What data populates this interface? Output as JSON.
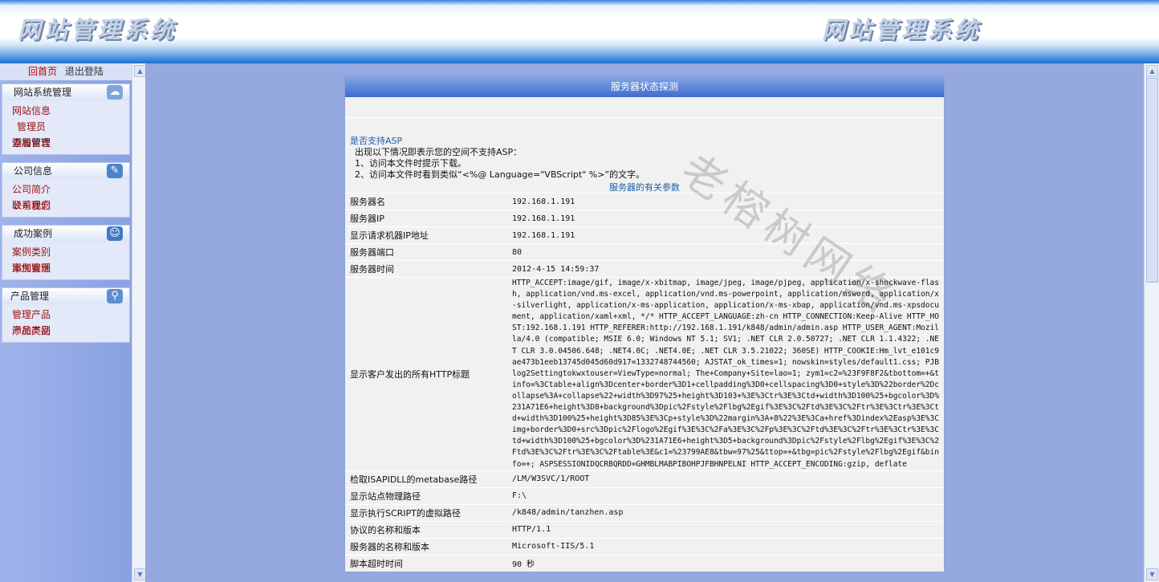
{
  "header": {
    "logo_left": "网站管理系统",
    "logo_right": "网站管理系统"
  },
  "sidebar": {
    "home": "回首页",
    "logout": "退出登陆",
    "groups": [
      {
        "title": "网站系统管理",
        "icon": "network-icon",
        "rows": [
          [
            "网站信息"
          ],
          [
            "管理员",
            "添加管理"
          ],
          [
            "查看留言"
          ]
        ]
      },
      {
        "title": "公司信息",
        "icon": "edit-icon",
        "rows": [
          [
            "公司简介",
            "联系我们"
          ],
          [
            "公司理念"
          ]
        ]
      },
      {
        "title": "成功案例",
        "icon": "user-icon",
        "rows": [
          [
            "案例类别",
            "案例管理"
          ],
          [
            "添加案例"
          ]
        ]
      },
      {
        "title": "产品管理",
        "icon": "search-icon",
        "rows": [
          [
            "管理产品",
            "添加产品"
          ],
          [
            "产品类别"
          ]
        ]
      }
    ]
  },
  "panel": {
    "title": "服务器状态探测",
    "asp_title": "是否支持ASP",
    "asp_line1": "出现以下情况即表示您的空间不支持ASP：",
    "asp_line2": "1、访问本文件时提示下载。",
    "asp_line3": "2、访问本文件时看到类似“<%@ Language=\"VBScript\" %>”的文字。",
    "section_title": "服务器的有关参数",
    "rows": [
      {
        "key": "服务器名",
        "value": "192.168.1.191"
      },
      {
        "key": "服务器IP",
        "value": "192.168.1.191"
      },
      {
        "key": "显示请求机器IP地址",
        "value": "192.168.1.191"
      },
      {
        "key": "服务器端口",
        "value": "80"
      },
      {
        "key": "服务器时间",
        "value": "2012-4-15 14:59:37"
      },
      {
        "key": "显示客户发出的所有HTTP标题",
        "long": true,
        "value": " HTTP_ACCEPT:image/gif, image/x-xbitmap, image/jpeg, image/pjpeg, application/x-shockwave-flash, application/vnd.ms-excel, application/vnd.ms-powerpoint, application/msword, application/x-silverlight, application/x-ms-application, application/x-ms-xbap, application/vnd.ms-xpsdocument, application/xaml+xml, */* HTTP_ACCEPT_LANGUAGE:zh-cn HTTP_CONNECTION:Keep-Alive HTTP_HOST:192.168.1.191 HTTP_REFERER:http://192.168.1.191/k848/admin/admin.asp HTTP_USER_AGENT:Mozilla/4.0 (compatible; MSIE 6.0; Windows NT 5.1; SV1; .NET CLR 2.0.50727; .NET CLR 1.1.4322; .NET CLR 3.0.04506.648; .NET4.0C; .NET4.0E; .NET CLR 3.5.21022; 360SE) HTTP_COOKIE:Hm_lvt_e101c9ae473b1eeb13745d045d60d917=1332748744560; AJSTAT_ok_times=1; nowskin=styles/default1.css; PJBlog2Settingtokwxtouser=ViewType=normal; The+Company+Site=lao=1; zym1=c2=%23F9F8F2&tbottom=+&tinfo=%3Ctable+align%3Dcenter+border%3D1+cellpadding%3D0+cellspacing%3D0+style%3D%22border%2Dcollapse%3A+collapse%22+width%3D97%25+height%3D103+%3E%3Ctr%3E%3Ctd+width%3D100%25+bgcolor%3D%231A71E6+height%3D8+background%3Dpic%2Fstyle%2Flbg%2Egif%3E%3C%2Ftd%3E%3C%2Ftr%3E%3Ctr%3E%3Ctd+width%3D100%25+height%3D85%3E%3Cp+style%3D%22margin%3A+8%22%3E%3Ca+href%3Dindex%2Easp%3E%3Cimg+border%3D0+src%3Dpic%2Flogo%2Egif%3E%3C%2Fa%3E%3C%2Fp%3E%3C%2Ftd%3E%3C%2Ftr%3E%3Ctr%3E%3Ctd+width%3D100%25+bgcolor%3D%231A71E6+height%3D5+background%3Dpic%2Fstyle%2Flbg%2Egif%3E%3C%2Ftd%3E%3C%2Ftr%3E%3C%2Ftable%3E&c1=%23799AE8&tbw=97%25&ttop=+&tbg=pic%2Fstyle%2Flbg%2Egif&binfo=+; ASPSESSIONIDQCRBQRDD=GHMBLMABPIBOHPJFBHNPELNI HTTP_ACCEPT_ENCODING:gzip, deflate"
      },
      {
        "key": "检取ISAPIDLL的metabase路径",
        "value": "/LM/W3SVC/1/ROOT"
      },
      {
        "key": "显示站点物理路径",
        "value": "F:\\"
      },
      {
        "key": "显示执行SCRIPT的虚拟路径",
        "value": "/k848/admin/tanzhen.asp"
      },
      {
        "key": "协议的名称和版本",
        "value": "HTTP/1.1"
      },
      {
        "key": "服务器的名称和版本",
        "value": "Microsoft-IIS/5.1"
      },
      {
        "key": "脚本超时时间",
        "value": "90 秒"
      }
    ]
  },
  "watermark": "老榕树网络"
}
